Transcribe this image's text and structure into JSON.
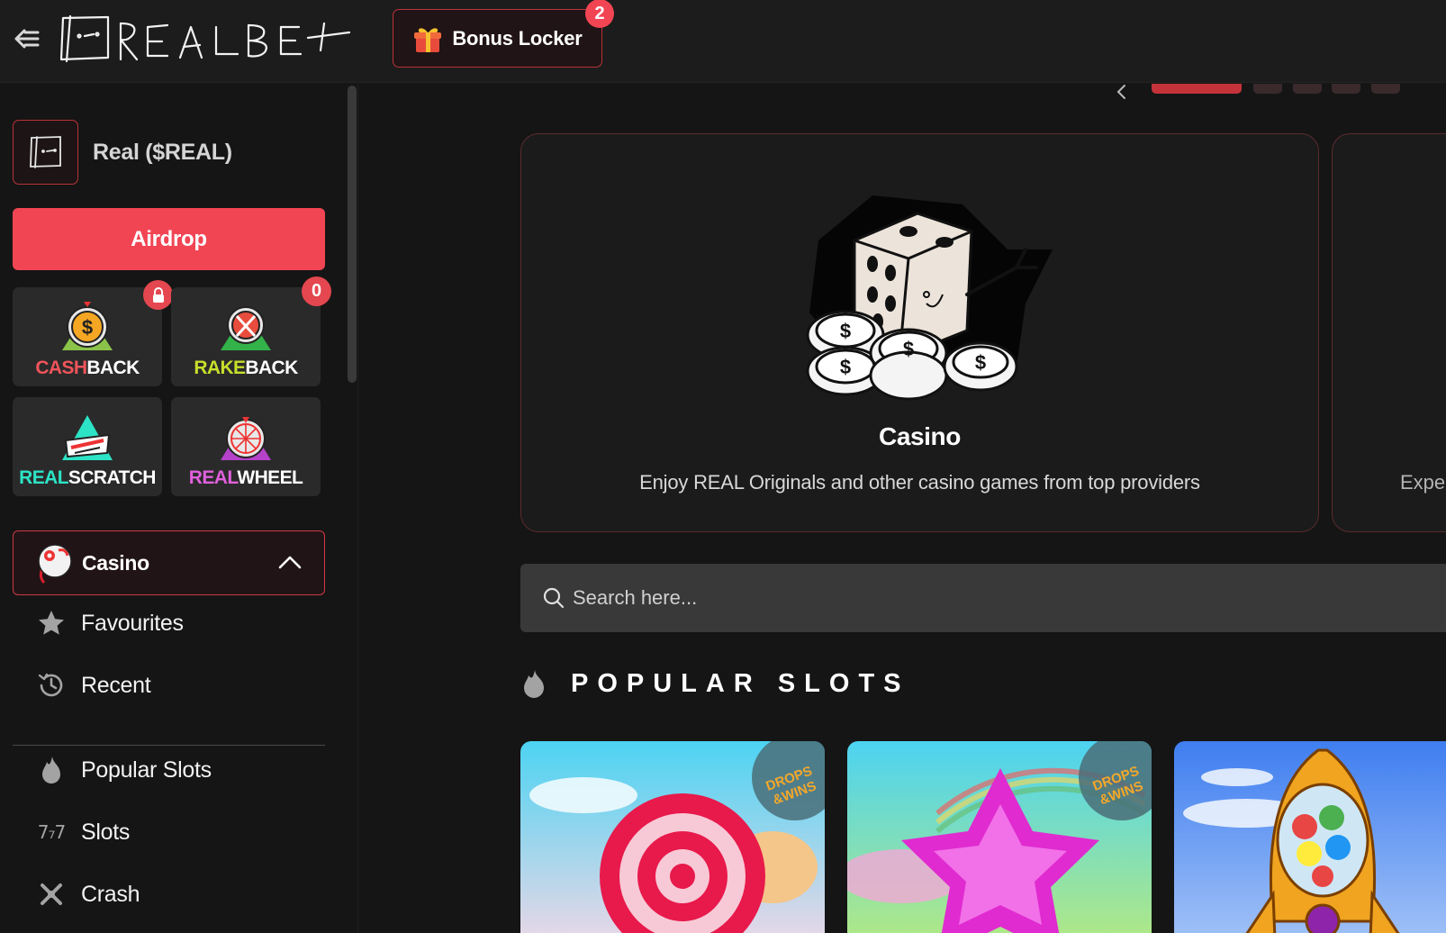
{
  "topbar": {
    "logo_text": "REALBET",
    "bonus_locker": {
      "label": "Bonus Locker",
      "badge": "2"
    }
  },
  "sidebar": {
    "token": {
      "name": "Real ($REAL)"
    },
    "airdrop_label": "Airdrop",
    "tiles": [
      {
        "prefix": "CASH",
        "suffix": "BACK",
        "accent": "#f0545b",
        "badge_icon": "lock-icon"
      },
      {
        "prefix": "RAKE",
        "suffix": "BACK",
        "accent": "#c8df2c",
        "badge": "0"
      },
      {
        "prefix": "REAL",
        "suffix": "SCRATCH",
        "accent": "#2de3c5"
      },
      {
        "prefix": "REAL",
        "suffix": "WHEEL",
        "accent": "#e060dc"
      }
    ],
    "casino_section": {
      "label": "Casino",
      "expanded": true
    },
    "items": [
      {
        "label": "Favourites",
        "icon": "star-icon"
      },
      {
        "label": "Recent",
        "icon": "history-icon"
      },
      {
        "label": "Popular Slots",
        "icon": "flame-icon"
      },
      {
        "label": "Slots",
        "icon": "777-icon",
        "icon_text": "7₇7"
      },
      {
        "label": "Crash",
        "icon": "crash-icon"
      }
    ]
  },
  "main": {
    "carousel": {
      "active_index": 0,
      "slides": [
        {
          "title": "Casino",
          "description": "Enjoy REAL Originals and other casino games from top providers"
        },
        {
          "description_partial": "Expe"
        }
      ]
    },
    "search": {
      "placeholder": "Search here..."
    },
    "popular_slots": {
      "title": "POPULAR SLOTS",
      "games": [
        {
          "badge": "DROPS & WINS",
          "badge_line1": "DROPS",
          "badge_line2": "&WINS"
        },
        {
          "badge": "DROPS & WINS",
          "badge_line1": "DROPS",
          "badge_line2": "&WINS"
        },
        {
          "badge": ""
        }
      ]
    }
  },
  "colors": {
    "accent": "#f24553",
    "border_red": "#b8333a",
    "background": "#151515",
    "topbar": "#1c1c1c"
  }
}
